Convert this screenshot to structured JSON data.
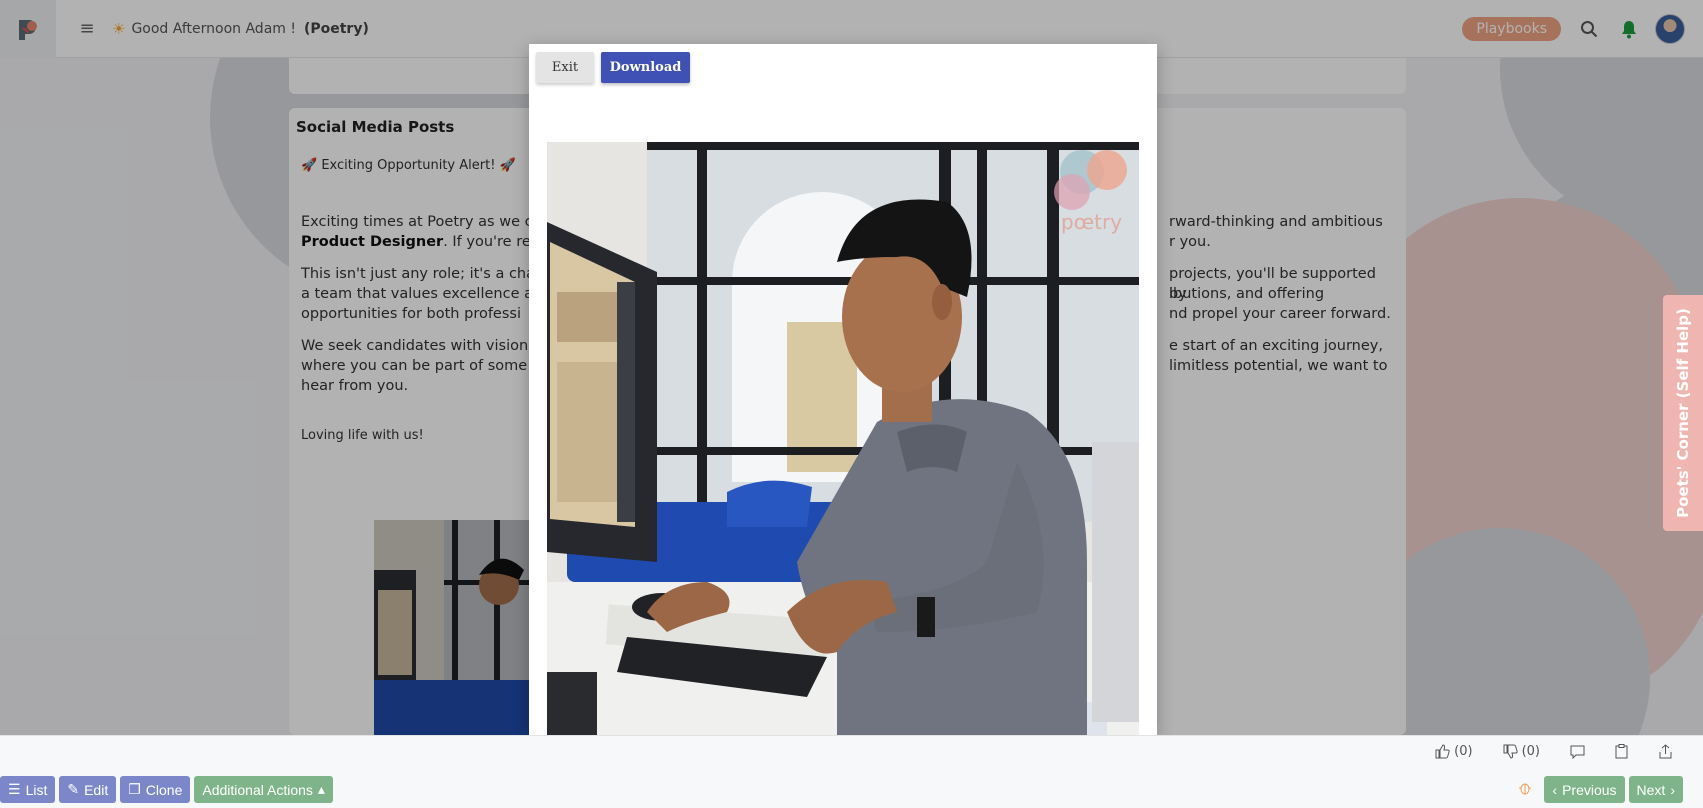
{
  "header": {
    "greeting": "Good Afternoon Adam !",
    "workspace": "(Poetry)",
    "playbooks_label": "Playbooks"
  },
  "post": {
    "title": "Social Media Posts",
    "alert": "Exciting Opportunity Alert!",
    "p1_left_a": "Exciting times at Poetry as we c",
    "p1_right_a": "rward-thinking and ambitious",
    "p1_bold": "Product Designer",
    "p1_left_b": ". If you're rea",
    "p1_right_b": "r you.",
    "p2_left_a": "This isn't just any role; it's a cha",
    "p2_right_a": "projects, you'll be supported by",
    "p2_left_b": "a team that values excellence a",
    "p2_right_b": "ibutions, and offering",
    "p2_left_c": "opportunities for both professi",
    "p2_right_c": "nd propel your career forward.",
    "p3_left_a": "We seek candidates with vision",
    "p3_right_a": "e start of an exciting journey,",
    "p3_left_b": "where you can be part of some",
    "p3_right_b": "limitless potential, we want to",
    "p3_left_c": "hear from you.",
    "loving": "Loving life with us!"
  },
  "modal": {
    "exit_label": "Exit",
    "download_label": "Download",
    "watermark": "pœtry"
  },
  "side_tab": {
    "label": "Poets' Corner (Self Help)"
  },
  "feedback": {
    "likes": "(0)",
    "dislikes": "(0)"
  },
  "actions": {
    "list": "List",
    "edit": "Edit",
    "clone": "Clone",
    "additional": "Additional Actions",
    "previous": "Previous",
    "next": "Next"
  },
  "colors": {
    "download": "#3f51b5",
    "playbooks": "#f0a483",
    "action_blue": "#7b87c9",
    "action_green": "#7fb48a",
    "side_tab": "#efb5b0"
  }
}
